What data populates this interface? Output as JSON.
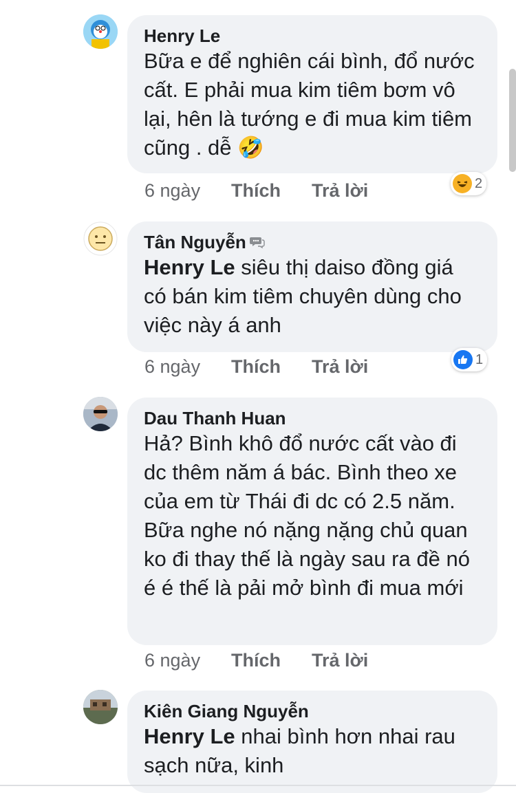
{
  "comments": [
    {
      "author": "Henry Le",
      "mention": "",
      "text": "Bữa e để nghiên cái bình, đổ nước cất. E phải mua kim tiêm bơm vô lại, hên là tướng e đi mua kim tiêm cũng .  dễ 🤣",
      "time": "6 ngày",
      "like": "Thích",
      "reply": "Trả lời",
      "reaction": {
        "icon": "haha-icon",
        "count": "2"
      }
    },
    {
      "author": "Tân Nguyễn",
      "mention": "Henry Le",
      "text": " siêu thị daiso đồng giá có bán kim tiêm chuyên dùng cho việc này á anh",
      "time": "6 ngày",
      "like": "Thích",
      "reply": "Trả lời",
      "reaction": {
        "icon": "like-icon",
        "count": "1"
      }
    },
    {
      "author": "Dau Thanh Huan",
      "mention": "",
      "text": "Hả? Bình khô đổ nước cất vào đi dc thêm năm á bác. Bình theo xe của em từ Thái đi dc có 2.5 năm. Bữa nghe nó nặng nặng chủ quan ko đi thay thế là ngày sau ra đề nó é é thế là pải mở bình đi mua mới",
      "time": "6 ngày",
      "like": "Thích",
      "reply": "Trả lời"
    },
    {
      "author": "Kiên Giang Nguyễn",
      "mention": "Henry Le",
      "text": " nhai bình hơn nhai rau sạch nữa, kinh"
    }
  ],
  "colors": {
    "bubble": "#f0f2f5",
    "meta": "#65676b",
    "like_blue": "#1877f2",
    "haha_yellow": "#f7b125"
  }
}
